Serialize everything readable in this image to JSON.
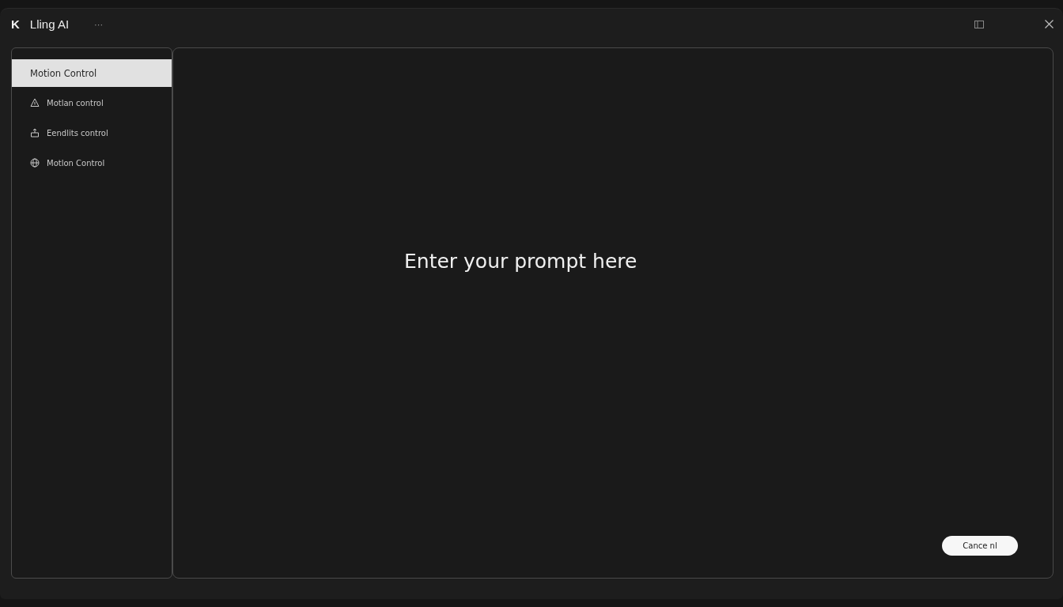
{
  "window": {
    "logo": "K",
    "title": "Lling AI",
    "menu": "···"
  },
  "sidebar": {
    "items": [
      {
        "label": "Motion Control",
        "selected": true
      },
      {
        "label": "Motlan control",
        "selected": false
      },
      {
        "label": "Eendlits control",
        "selected": false
      },
      {
        "label": "Motlon Control",
        "selected": false
      }
    ]
  },
  "prompt": {
    "placeholder": "Enter your prompt here"
  },
  "buttons": [
    {
      "label": "Cance nl"
    }
  ]
}
